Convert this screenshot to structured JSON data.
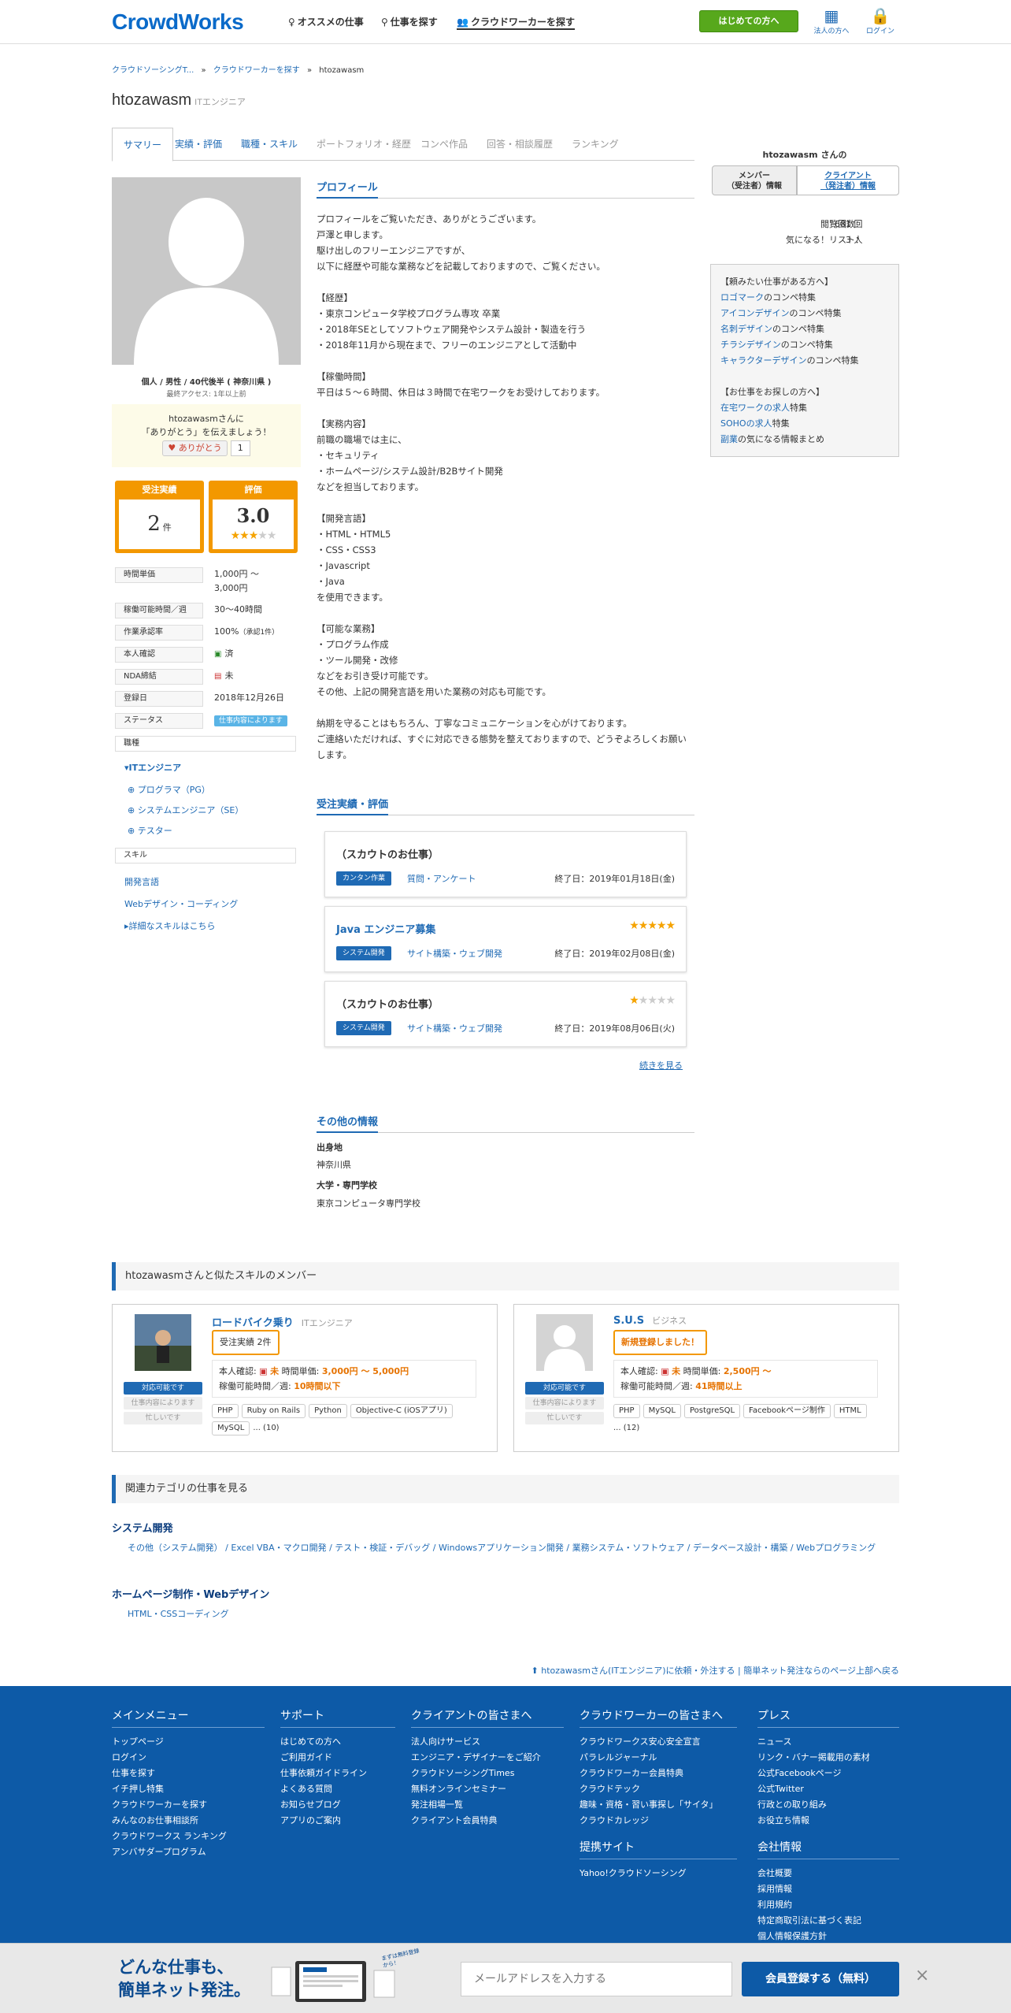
{
  "header": {
    "logo": "CrowdWorks",
    "nav": [
      "オススメの仕事",
      "仕事を探す",
      "クラウドワーカーを探す"
    ],
    "start_button": "はじめての方へ",
    "corp_label": "法人の方へ",
    "login_label": "ログイン"
  },
  "breadcrumb": [
    "クラウドソーシングT...",
    "クラウドワーカーを探す",
    "htozawasm"
  ],
  "profile": {
    "username": "htozawasm",
    "role": "ITエンジニア",
    "demographics": "個人 / 男性 / 40代後半 ( 神奈川県 )",
    "last_access": "最終アクセス: 1年以上前",
    "thanks_line1": "htozawasmさんに",
    "thanks_line2": "「ありがとう」を伝えましょう！",
    "thanks_button": "ありがとう",
    "thanks_count": "1",
    "stat_orders_label": "受注実績",
    "stat_orders_value": "2",
    "stat_orders_unit": "件",
    "stat_rating_label": "評価",
    "stat_rating_value": "3.0",
    "stat_rating_stars": "★★★★★",
    "details": [
      {
        "label": "時間単価",
        "value": "1,000円 〜\n3,000円"
      },
      {
        "label": "稼働可能時間／週",
        "value": "30〜40時間"
      },
      {
        "label": "作業承認率",
        "value": "100%",
        "extra": "（承認1件）"
      },
      {
        "label": "本人確認",
        "value": "済"
      },
      {
        "label": "NDA締結",
        "value": "未"
      },
      {
        "label": "登録日",
        "value": "2018年12月26日"
      },
      {
        "label": "ステータス",
        "value": "仕事内容によります"
      }
    ],
    "job_type_label": "職種",
    "job_type_main": "ITエンジニア",
    "job_types": [
      "プログラマ（PG）",
      "システムエンジニア（SE）",
      "テスター"
    ],
    "skill_label": "スキル",
    "skills": [
      "開発言語",
      "Webデザイン・コーディング"
    ],
    "skill_more": "詳細なスキルはこちら"
  },
  "tabs": [
    "サマリー",
    "実績・評価",
    "職種・スキル",
    "ポートフォリオ・経歴",
    "コンペ作品",
    "回答・相談履歴",
    "ランキング"
  ],
  "profile_section": {
    "heading": "プロフィール",
    "text": "プロフィールをご覧いただき、ありがとうございます。\n戸澤と申します。\n駆け出しのフリーエンジニアですが、\n以下に経歴や可能な業務などを記載しておりますので、ご覧ください。\n\n【経歴】\n・東京コンピュータ学校プログラム専攻 卒業\n・2018年SEとしてソフトウェア開発やシステム設計・製造を行う\n・2018年11月から現在まで、フリーのエンジニアとして活動中\n\n【稼働時間】\n平日は５～６時間、休日は３時間で在宅ワークをお受けしております。\n\n【実務内容】\n前職の職場では主に、\n・セキュリティ\n・ホームページ/システム設計/B2Bサイト開発\nなどを担当しております。\n\n【開発言語】\n・HTML・HTML5\n・CSS・CSS3\n・Javascript\n・Java\nを使用できます。\n\n【可能な業務】\n・プログラム作成\n・ツール開発・改修\nなどをお引き受け可能です。\nその他、上記の開発言語を用いた業務の対応も可能です。\n\n納期を守ることはもちろん、丁寧なコミュニケーションを心がけております。\nご連絡いただければ、すぐに対応できる態勢を整えておりますので、どうぞよろしくお願いします。"
  },
  "works_section": {
    "heading": "受注実績・評価",
    "jobs": [
      {
        "title": "（スカウトのお仕事）",
        "tag": "カンタン作業",
        "category": "質問・アンケート",
        "date": "終了日：2019年01月18日(金)",
        "stars": 0
      },
      {
        "title": "Java エンジニア募集",
        "tag": "システム開発",
        "category": "サイト構築・ウェブ開発",
        "date": "終了日：2019年02月08日(金)",
        "stars": 5
      },
      {
        "title": "（スカウトのお仕事）",
        "tag": "システム開発",
        "category": "サイト構築・ウェブ開発",
        "date": "終了日：2019年08月06日(火)",
        "stars": 1
      }
    ],
    "more": "続きを見る"
  },
  "other_section": {
    "heading": "その他の情報",
    "birthplace_label": "出身地",
    "birthplace": "神奈川県",
    "school_label": "大学・専門学校",
    "school": "東京コンピュータ専門学校"
  },
  "sidebar": {
    "name": "htozawasm さんの",
    "tab_member": "メンバー\n（受注者）情報",
    "tab_client": "クライアント\n（発注者）情報",
    "views_label": "閲覧回数：",
    "views_value": "681 回",
    "fav_label": "気になる！リスト：",
    "fav_value": "3 人",
    "box_head1": "【頼みたい仕事がある方へ】",
    "box_links1": [
      [
        "ロゴマーク",
        "のコンペ特集"
      ],
      [
        "アイコンデザイン",
        "のコンペ特集"
      ],
      [
        "名刺デザイン",
        "のコンペ特集"
      ],
      [
        "チラシデザイン",
        "のコンペ特集"
      ],
      [
        "キャラクターデザイン",
        "のコンペ特集"
      ]
    ],
    "box_head2": "【お仕事をお探しの方へ】",
    "box_links2": [
      [
        "在宅ワークの求人",
        "特集"
      ],
      [
        "SOHOの求人",
        "特集"
      ],
      [
        "副業",
        "の気になる情報まとめ"
      ]
    ]
  },
  "similar": {
    "heading": "htozawasmさんと似たスキルのメンバー",
    "members": [
      {
        "name": "ロードバイク乗り",
        "role": "ITエンジニア",
        "badge": "受注実績 2件",
        "identity": "未",
        "rate": "3,000円 〜 5,000円",
        "hours": "10時間以下",
        "status": "対応可能です",
        "s2": "仕事内容によります",
        "s3": "忙しいです",
        "skills": [
          "PHP",
          "Ruby on Rails",
          "Python",
          "Objective-C (iOSアプリ)",
          "MySQL"
        ],
        "more": "... (10)"
      },
      {
        "name": "S.U.S",
        "role": "ビジネス",
        "badge": "新規登録しました！",
        "identity": "未",
        "rate": "2,500円 〜",
        "hours": "41時間以上",
        "status": "対応可能です",
        "s2": "仕事内容によります",
        "s3": "忙しいです",
        "skills": [
          "PHP",
          "MySQL",
          "PostgreSQL",
          "Facebookページ制作",
          "HTML"
        ],
        "more": "... (12)"
      }
    ],
    "identity_label": "本人確認:",
    "rate_label": "時間単価:",
    "hours_label": "稼働可能時間／週:"
  },
  "related": {
    "heading": "関連カテゴリの仕事を見る",
    "cat1": "システム開発",
    "cat1_links": "その他（システム開発） / Excel VBA・マクロ開発 / テスト・検証・デバッグ / Windowsアプリケーション開発 / 業務システム・ソフトウェア / データベース設計・構築 / Webプログラミング",
    "cat2": "ホームページ制作・Webデザイン",
    "cat2_links": "HTML・CSSコーディング",
    "footer_link": "htozawasmさん(ITエンジニア)に依頼・外注する | 簡単ネット発注ならのページ上部へ戻る"
  },
  "footer": {
    "cols": [
      {
        "title": "メインメニュー",
        "items": [
          "トップページ",
          "ログイン",
          "仕事を探す",
          "イチ押し特集",
          "クラウドワーカーを探す",
          "みんなのお仕事相談所",
          "クラウドワークス ランキング",
          "アンバサダープログラム"
        ]
      },
      {
        "title": "サポート",
        "items": [
          "はじめての方へ",
          "ご利用ガイド",
          "仕事依頼ガイドライン",
          "よくある質問",
          "お知らせブログ",
          "アプリのご案内"
        ]
      },
      {
        "title": "クライアントの皆さまへ",
        "items": [
          "法人向けサービス",
          "エンジニア・デザイナーをご紹介",
          "クラウドソーシングTimes",
          "無料オンラインセミナー",
          "発注相場一覧",
          "クライアント会員特典"
        ]
      },
      {
        "title": "クラウドワーカーの皆さまへ",
        "items": [
          "クラウドワークス安心安全宣言",
          "パラレルジャーナル",
          "クラウドワーカー会員特典",
          "クラウドテック",
          "趣味・資格・習い事探し「サイタ」",
          "クラウドカレッジ"
        ]
      },
      {
        "title": "プレス",
        "items": [
          "ニュース",
          "リンク・バナー掲載用の素材",
          "公式Facebookページ",
          "公式Twitter",
          "行政との取り組み",
          "お役立ち情報"
        ]
      }
    ],
    "col6_title": "提携サイト",
    "col6_items": [
      "Yahoo!クラウドソーシング"
    ],
    "col7_title": "会社情報",
    "col7_items": [
      "会社概要",
      "採用情報",
      "利用規約",
      "特定商取引法に基づく表記",
      "個人情報保護方針"
    ]
  },
  "bottombar": {
    "line1": "どんな仕事も、",
    "line2": "簡単ネット発注。",
    "email_placeholder": "メールアドレスを入力する",
    "register": "会員登録する（無料）",
    "close": "×",
    "badge": "まずは無料登録から！"
  }
}
